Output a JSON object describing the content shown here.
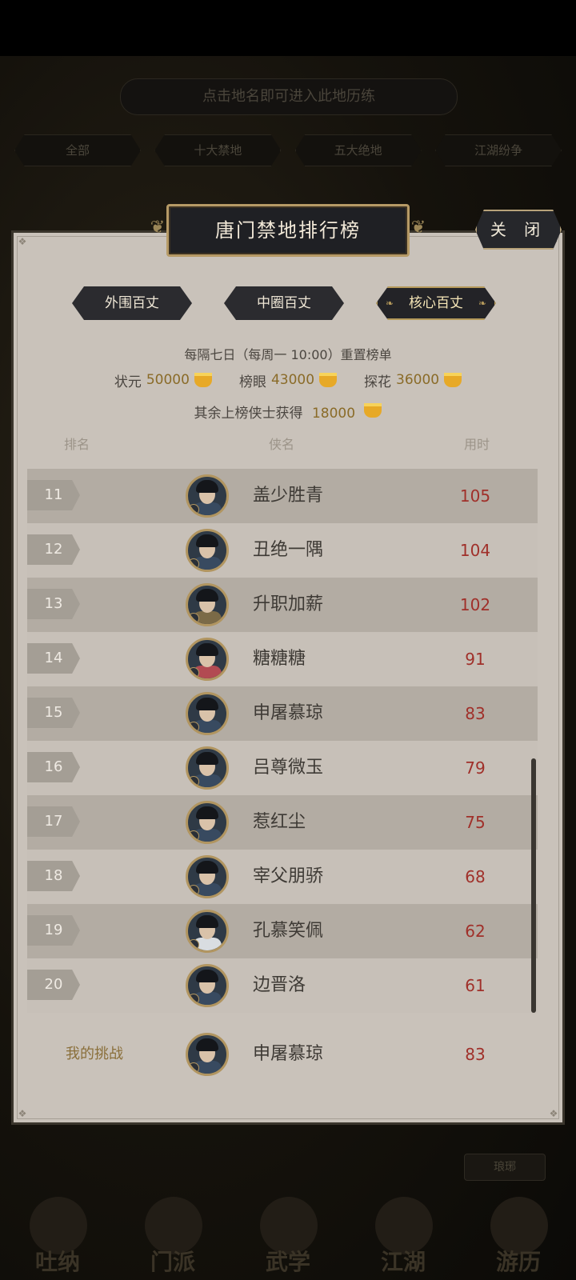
{
  "background": {
    "hint": "点击地名即可进入此地历练",
    "tabs": [
      "全部",
      "十大禁地",
      "五大绝地",
      "江湖纷争"
    ],
    "side_tab": "琅琊",
    "nav": [
      "吐纳",
      "门派",
      "武学",
      "江湖",
      "游历"
    ]
  },
  "panel": {
    "title": "唐门禁地排行榜",
    "close_label": "关 闭",
    "sub_tabs": [
      {
        "label": "外围百丈",
        "active": false
      },
      {
        "label": "中圈百丈",
        "active": false
      },
      {
        "label": "核心百丈",
        "active": true
      }
    ],
    "reset_text": "每隔七日（每周一 10:00）重置榜单",
    "rewards": [
      {
        "label": "状元",
        "value": "50000"
      },
      {
        "label": "榜眼",
        "value": "43000"
      },
      {
        "label": "探花",
        "value": "36000"
      }
    ],
    "others_reward": {
      "label": "其余上榜侠士获得",
      "value": "18000"
    },
    "columns": {
      "rank": "排名",
      "name": "侠名",
      "time": "用时"
    },
    "rows": [
      {
        "rank": "11",
        "name": "盖少胜青",
        "time": "105",
        "avatar": "male"
      },
      {
        "rank": "12",
        "name": "丑绝一隅",
        "time": "104",
        "avatar": "male"
      },
      {
        "rank": "13",
        "name": "升职加薪",
        "time": "102",
        "avatar": "male2"
      },
      {
        "rank": "14",
        "name": "糖糖糖",
        "time": "91",
        "avatar": "female"
      },
      {
        "rank": "15",
        "name": "申屠慕琼",
        "time": "83",
        "avatar": "male"
      },
      {
        "rank": "16",
        "name": "吕尊微玉",
        "time": "79",
        "avatar": "male"
      },
      {
        "rank": "17",
        "name": "惹红尘",
        "time": "75",
        "avatar": "male"
      },
      {
        "rank": "18",
        "name": "宰父朋骄",
        "time": "68",
        "avatar": "male"
      },
      {
        "rank": "19",
        "name": "孔慕笑佩",
        "time": "62",
        "avatar": "white"
      },
      {
        "rank": "20",
        "name": "边晋洛",
        "time": "61",
        "avatar": "male"
      }
    ],
    "mine": {
      "label": "我的挑战",
      "name": "申屠慕琼",
      "time": "83"
    }
  }
}
